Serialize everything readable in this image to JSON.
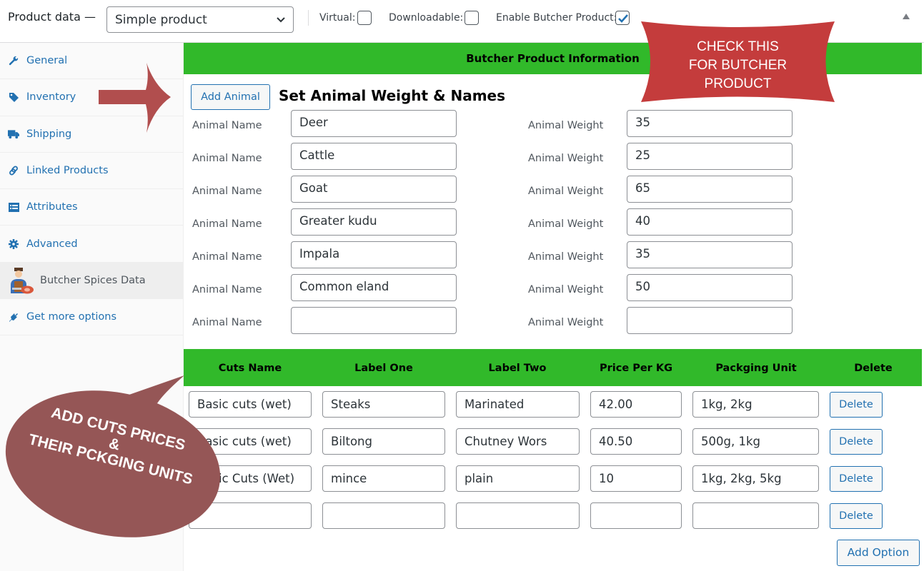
{
  "header": {
    "title": "Product data —",
    "product_type": "Simple product",
    "virtual_label": "Virtual:",
    "virtual_checked": false,
    "downloadable_label": "Downloadable:",
    "downloadable_checked": false,
    "butcher_label": "Enable Butcher Product:",
    "butcher_checked": true
  },
  "sidebar": {
    "items": [
      {
        "label": "General",
        "icon": "wrench-icon"
      },
      {
        "label": "Inventory",
        "icon": "tag-icon"
      },
      {
        "label": "Shipping",
        "icon": "truck-icon"
      },
      {
        "label": "Linked Products",
        "icon": "link-icon"
      },
      {
        "label": "Attributes",
        "icon": "list-icon"
      },
      {
        "label": "Advanced",
        "icon": "gear-icon"
      },
      {
        "label": "Butcher Spices Data",
        "icon": "butcher-icon",
        "active": true
      },
      {
        "label": "Get more options",
        "icon": "plug-icon"
      }
    ]
  },
  "butcher": {
    "section_header": "Butcher Product Information",
    "add_animal_label": "Add Animal",
    "animals_title": "Set Animal Weight & Names",
    "name_label": "Animal Name",
    "weight_label": "Animal Weight",
    "animals": [
      {
        "name": "Deer",
        "weight": "35"
      },
      {
        "name": "Cattle",
        "weight": "25"
      },
      {
        "name": "Goat",
        "weight": "65"
      },
      {
        "name": "Greater kudu",
        "weight": "40"
      },
      {
        "name": "Impala",
        "weight": "35"
      },
      {
        "name": "Common eland",
        "weight": "50"
      },
      {
        "name": "",
        "weight": ""
      }
    ]
  },
  "cuts": {
    "columns": [
      "Cuts Name",
      "Label One",
      "Label Two",
      "Price Per KG",
      "Packging Unit",
      "Delete"
    ],
    "delete_label": "Delete",
    "add_option_label": "Add Option",
    "rows": [
      {
        "name": "Basic cuts (wet)",
        "label_one": "Steaks",
        "label_two": "Marinated",
        "price": "42.00",
        "unit": "1kg, 2kg"
      },
      {
        "name": "Basic cuts (wet)",
        "label_one": "Biltong",
        "label_two": "Chutney Wors",
        "price": "40.50",
        "unit": "500g, 1kg"
      },
      {
        "name": "Basic Cuts (Wet)",
        "label_one": "mince",
        "label_two": "plain",
        "price": "10",
        "unit": "1kg, 2kg, 5kg"
      },
      {
        "name": "",
        "label_one": "",
        "label_two": "",
        "price": "",
        "unit": ""
      }
    ]
  },
  "annotations": {
    "check_callout": [
      "CHECK THIS",
      "FOR BUTCHER",
      "PRODUCT"
    ],
    "cuts_callout": [
      "ADD CUTS PRICES",
      "&",
      "THEIR PCKGING UNITS"
    ],
    "colors": {
      "green": "#31b92a",
      "banner_red": "#c43c3c",
      "bubble": "#955656",
      "arrow": "#b14e4e"
    }
  }
}
